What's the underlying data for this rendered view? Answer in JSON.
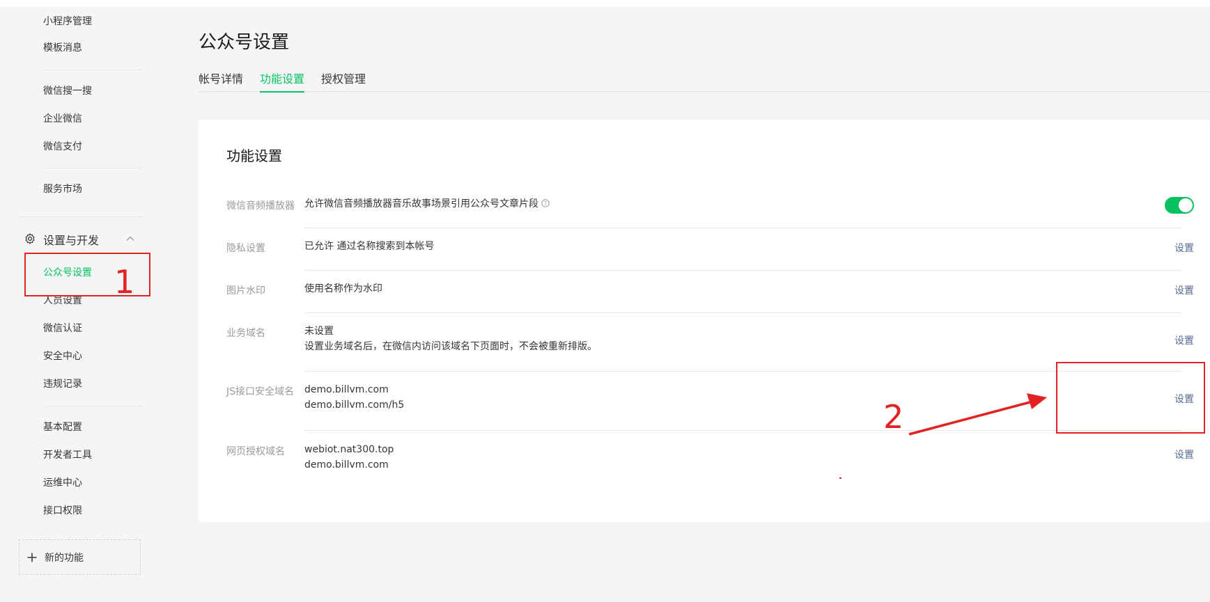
{
  "sidebar": {
    "items_top": [
      {
        "label": "小程序管理"
      },
      {
        "label": "模板消息"
      },
      {
        "label": "微信搜一搜"
      },
      {
        "label": "企业微信"
      },
      {
        "label": "微信支付"
      },
      {
        "label": "服务市场"
      }
    ],
    "group": {
      "label": "设置与开发",
      "icon": "gear-icon",
      "expanded": true
    },
    "group_items": [
      {
        "label": "公众号设置",
        "active": true
      },
      {
        "label": "人员设置"
      },
      {
        "label": "微信认证"
      },
      {
        "label": "安全中心"
      },
      {
        "label": "违规记录"
      }
    ],
    "dev_items": [
      {
        "label": "基本配置"
      },
      {
        "label": "开发者工具"
      },
      {
        "label": "运维中心"
      },
      {
        "label": "接口权限"
      }
    ],
    "new_feature": {
      "label": "新的功能",
      "icon": "plus-icon"
    }
  },
  "header": {
    "title": "公众号设置",
    "tabs": [
      {
        "label": "帐号详情"
      },
      {
        "label": "功能设置",
        "active": true
      },
      {
        "label": "授权管理"
      }
    ]
  },
  "card": {
    "title": "功能设置",
    "rows": [
      {
        "label": "微信音频播放器",
        "lines": [
          "允许微信音频播放器音乐故事场景引用公众号文章片段"
        ],
        "toggle_on": true
      },
      {
        "label": "隐私设置",
        "lines": [
          "已允许 通过名称搜索到本帐号"
        ],
        "action": "设置"
      },
      {
        "label": "图片水印",
        "lines": [
          "使用名称作为水印"
        ],
        "action": "设置"
      },
      {
        "label": "业务域名",
        "lines": [
          "未设置",
          "设置业务域名后，在微信内访问该域名下页面时，不会被重新排版。"
        ],
        "action": "设置"
      },
      {
        "label": "JS接口安全域名",
        "lines": [
          "demo.billvm.com",
          "demo.billvm.com/h5"
        ],
        "action": "设置"
      },
      {
        "label": "网页授权域名",
        "lines": [
          "webiot.nat300.top",
          "demo.billvm.com"
        ],
        "action": "设置"
      }
    ]
  },
  "annotations": {
    "step1": "1",
    "step2": "2",
    "color": "#e32222"
  },
  "colors": {
    "accent": "#07c160",
    "link": "#576b95",
    "background": "#f4f5f7"
  }
}
